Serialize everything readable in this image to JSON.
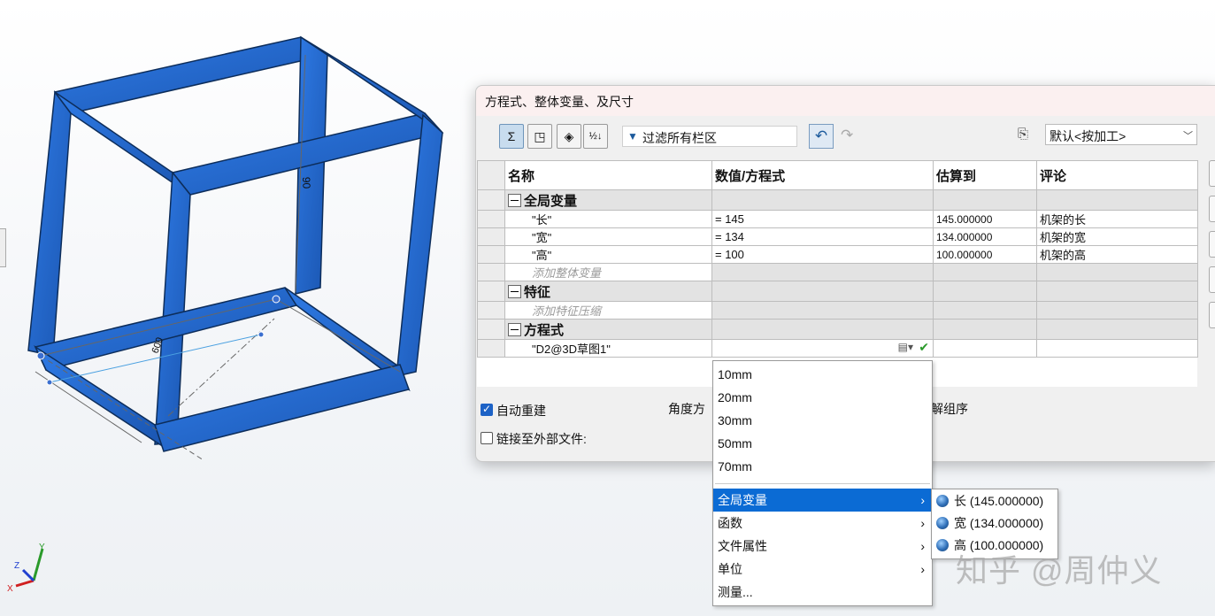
{
  "dialog": {
    "title": "方程式、整体变量、及尺寸",
    "filter_text": "过滤所有栏区",
    "configuration": "默认<按加工>"
  },
  "toolbar_icons": [
    "equation-view-icon",
    "sketch-equation-view-icon",
    "dimension-view-icon",
    "ordered-view-icon"
  ],
  "table": {
    "headers": [
      "名称",
      "数值/方程式",
      "估算到",
      "评论"
    ],
    "sections": {
      "globals": "全局变量",
      "features": "特征",
      "equations": "方程式"
    },
    "globals": [
      {
        "name": "\"长\"",
        "value": "= 145",
        "eval": "145.000000",
        "comment": "机架的长"
      },
      {
        "name": "\"宽\"",
        "value": "= 134",
        "eval": "134.000000",
        "comment": "机架的宽"
      },
      {
        "name": "\"高\"",
        "value": "= 100",
        "eval": "100.000000",
        "comment": "机架的高"
      }
    ],
    "add_global": "添加整体变量",
    "add_feature": "添加特征压缩",
    "equation_row": {
      "name": "\"D2@3D草图1\"",
      "value": ""
    }
  },
  "options": {
    "auto_rebuild": "自动重建",
    "auto_rebuild_checked": true,
    "link_external": "链接至外部文件:",
    "link_external_checked": false,
    "angle_units_partial": "角度方",
    "solve_order_partial": "解组序"
  },
  "value_menu": {
    "items": [
      "10mm",
      "20mm",
      "30mm",
      "50mm",
      "70mm"
    ],
    "submenus": [
      "全局变量",
      "函数",
      "文件属性",
      "单位"
    ],
    "measure": "测量...",
    "highlighted": "全局变量"
  },
  "global_submenu": [
    "长 (145.000000)",
    "宽 (134.000000)",
    "高 (100.000000)"
  ],
  "model": {
    "dim_top": "90",
    "dim_left": "600",
    "triad": {
      "x": "X",
      "y": "Y",
      "z": "Z"
    }
  },
  "watermark": "知乎 @周仲义",
  "colors": {
    "frame": "#1f6ad3",
    "highlight": "#0b6bd4"
  }
}
